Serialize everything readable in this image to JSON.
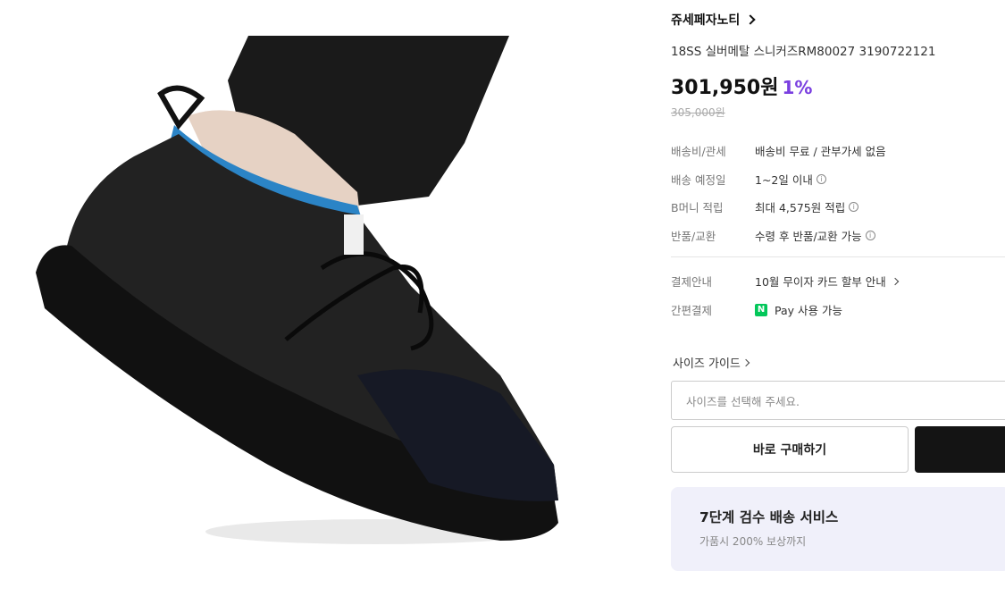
{
  "product": {
    "brand": "쥬세페자노티",
    "title": "18SS 실버메탈 스니커즈RM80027 3190722121",
    "price": "301,950원",
    "discount": "1%",
    "original_price": "305,000원"
  },
  "details": [
    {
      "label": "배송비/관세",
      "value": "배송비 무료 / 관부가세 없음"
    },
    {
      "label": "배송 예정일",
      "value": "1~2일 이내"
    },
    {
      "label": "B머니 적립",
      "value": "최대 4,575원 적립"
    },
    {
      "label": "반품/교환",
      "value": "수령 후 반품/교환 가능"
    }
  ],
  "payment": {
    "label": "결제안내",
    "value": "10월 무이자 카드 할부 안내",
    "easy_label": "간편결제",
    "npay_logo": "N",
    "npay_value": "Pay 사용 가능"
  },
  "size": {
    "guide_label": "사이즈 가이드",
    "placeholder": "사이즈를 선택해 주세요."
  },
  "buttons": {
    "buy_now": "바로 구매하기"
  },
  "promo": {
    "title": "7단계 검수 배송 서비스",
    "subtitle": "가품시 200% 보상까지"
  },
  "colors": {
    "discount": "#7a3fe0",
    "npay": "#03c75a",
    "dark_button": "#141414",
    "promo_bg": "#f0f0fa"
  }
}
